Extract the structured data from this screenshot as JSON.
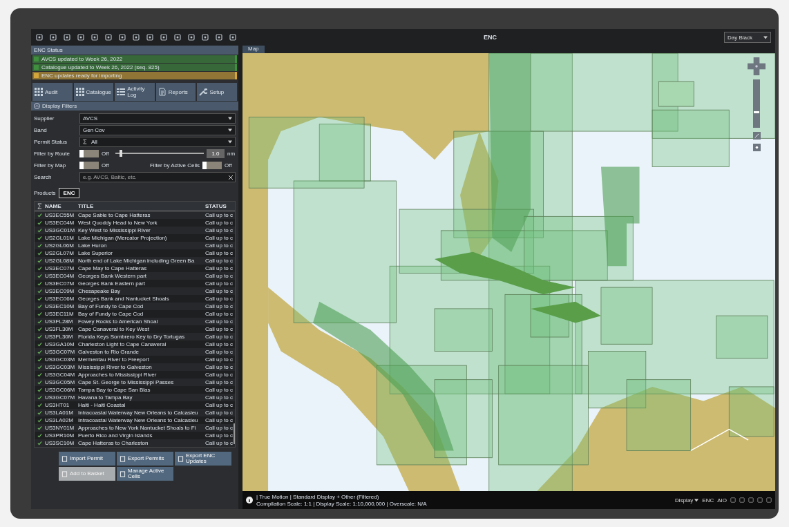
{
  "window": {
    "title": "ENC"
  },
  "palette": {
    "value": "Day Black"
  },
  "enc_status": {
    "title": "ENC Status",
    "messages": [
      {
        "text": "AVCS updated to Week 26, 2022",
        "color": "#3f8f3f"
      },
      {
        "text": "Catalogue updated to Week 26, 2022 (seq. 825)",
        "color": "#3f8f3f"
      },
      {
        "text": "ENC updates ready for importing",
        "color": "#d4a53a"
      }
    ]
  },
  "tabs": [
    {
      "label": "Audit",
      "kind": "grid"
    },
    {
      "label": "Catalogue",
      "kind": "grid"
    },
    {
      "label": "Activity Log",
      "kind": "list"
    },
    {
      "label": "Reports",
      "kind": "report"
    },
    {
      "label": "Setup",
      "kind": "wrench"
    }
  ],
  "display_filters": {
    "title": "Display Filters",
    "expanded": true,
    "supplier": {
      "label": "Supplier",
      "value": "AVCS"
    },
    "band": {
      "label": "Band",
      "value": "Gen Cov"
    },
    "permit_status": {
      "label": "Permit Status",
      "value": "All"
    },
    "filter_by_route": {
      "label": "Filter by Route",
      "on": false,
      "state_text": "Off",
      "level": 0.05,
      "value": "1.0",
      "unit": "nm"
    },
    "filter_by_map": {
      "label": "Filter by Map",
      "on": false,
      "state_text": "Off"
    },
    "filter_by_active_cells": {
      "label": "Filter by Active Cells",
      "on": false,
      "state_text": "Off"
    },
    "search": {
      "label": "Search",
      "placeholder": "e.g. AVCS, Baltic, etc."
    }
  },
  "products": {
    "label": "Products",
    "options": [
      {
        "label": "ENC",
        "selected": true
      }
    ]
  },
  "table": {
    "columns": [
      "NAME",
      "TITLE",
      "STATUS"
    ],
    "rows": [
      {
        "name": "US3EC55M",
        "title": "Cape Sable to Cape Hatteras",
        "status": "Call up to c",
        "checked": true
      },
      {
        "name": "US3EC04M",
        "title": "West Quoddy Head to New York",
        "status": "Call up to c",
        "checked": true
      },
      {
        "name": "US3GC01M",
        "title": "Key West to Mississippi River",
        "status": "Call up to c",
        "checked": true
      },
      {
        "name": "US2GL01M",
        "title": "Lake Michigan (Mercator Projection)",
        "status": "Call up to c",
        "checked": true
      },
      {
        "name": "US2GL06M",
        "title": "Lake Huron",
        "status": "Call up to c",
        "checked": true
      },
      {
        "name": "US2GL07M",
        "title": "Lake Superior",
        "status": "Call up to c",
        "checked": true
      },
      {
        "name": "US2GL08M",
        "title": "North end of Lake Michigan including Green Ba",
        "status": "Call up to c",
        "checked": true
      },
      {
        "name": "US3EC07M",
        "title": "Cape May to Cape Hatteras",
        "status": "Call up to c",
        "checked": true
      },
      {
        "name": "US3EC04M",
        "title": "Georges Bank Western part",
        "status": "Call up to c",
        "checked": true
      },
      {
        "name": "US3EC07M",
        "title": "Georges Bank Eastern part",
        "status": "Call up to c",
        "checked": true
      },
      {
        "name": "US3EC09M",
        "title": "Chesapeake Bay",
        "status": "Call up to c",
        "checked": true
      },
      {
        "name": "US3EC06M",
        "title": "Georges Bank and Nantucket Shoals",
        "status": "Call up to c",
        "checked": true
      },
      {
        "name": "US3EC10M",
        "title": "Bay of Fundy to Cape Cod",
        "status": "Call up to c",
        "checked": true
      },
      {
        "name": "US3EC11M",
        "title": "Bay of Fundy to Cape Cod",
        "status": "Call up to c",
        "checked": true
      },
      {
        "name": "US3FL28M",
        "title": "Fowey Rocks to American Shoal",
        "status": "Call up to c",
        "checked": true
      },
      {
        "name": "US3FL30M",
        "title": "Cape Canaveral to Key West",
        "status": "Call up to c",
        "checked": true
      },
      {
        "name": "US3FL30M",
        "title": "Florida Keys Sombrero Key to Dry Tortugas",
        "status": "Call up to c",
        "checked": true
      },
      {
        "name": "US3GA10M",
        "title": "Charleston Light to Cape Canaveral",
        "status": "Call up to c",
        "checked": true
      },
      {
        "name": "US3GC07M",
        "title": "Galveston to Rio Grande",
        "status": "Call up to c",
        "checked": true
      },
      {
        "name": "US3GC03M",
        "title": "Mermentau River to Freeport",
        "status": "Call up to c",
        "checked": true
      },
      {
        "name": "US3GC03M",
        "title": "Mississippi River to Galveston",
        "status": "Call up to c",
        "checked": true
      },
      {
        "name": "US3GC04M",
        "title": "Approaches to Mississippi River",
        "status": "Call up to c",
        "checked": true
      },
      {
        "name": "US3GC05M",
        "title": "Cape St. George to Mississippi Passes",
        "status": "Call up to c",
        "checked": true
      },
      {
        "name": "US3GC06M",
        "title": "Tampa Bay to Cape San Blas",
        "status": "Call up to c",
        "checked": true
      },
      {
        "name": "US3GC07M",
        "title": "Havana to Tampa Bay",
        "status": "Call up to c",
        "checked": true
      },
      {
        "name": "US3HT01",
        "title": "Haiti - Haiti Coastal",
        "status": "Call up to c",
        "checked": true
      },
      {
        "name": "US3LA01M",
        "title": "Intracoastal Waterway New Orleans to Calcasieu",
        "status": "Call up to c",
        "checked": true
      },
      {
        "name": "US3LA02M",
        "title": "Intracoastal Waterway New Orleans to Calcasieu",
        "status": "Call up to c",
        "checked": true
      },
      {
        "name": "US3NY01M",
        "title": "Approaches to New York Nantucket Shoals to Fi",
        "status": "Call up to c",
        "checked": true
      },
      {
        "name": "US3PR10M",
        "title": "Puerto Rico and Virgin Islands",
        "status": "Call up to c",
        "checked": true
      },
      {
        "name": "US3SC10M",
        "title": "Cape Hatteras to Charleston",
        "status": "Call up to c",
        "checked": true
      }
    ]
  },
  "actions": [
    {
      "label": "Import Permit",
      "disabled": false
    },
    {
      "label": "Export Permits",
      "disabled": false
    },
    {
      "label": "Export ENC Updates",
      "disabled": false
    },
    {
      "label": "Add to Basket",
      "disabled": true
    },
    {
      "label": "Manage Active Cells",
      "disabled": false
    }
  ],
  "map": {
    "tab": "Map",
    "zoom": {
      "level": 0.3
    }
  },
  "status_bar": {
    "line_1": "| True Motion | Standard Display + Other (Filtered)",
    "line_2": "Compilation Scale: 1:1 | Display Scale: 1:10,000,000 | Overscale: N/A",
    "display": "Display",
    "mode_1": "ENC",
    "mode_2": "AIO"
  }
}
